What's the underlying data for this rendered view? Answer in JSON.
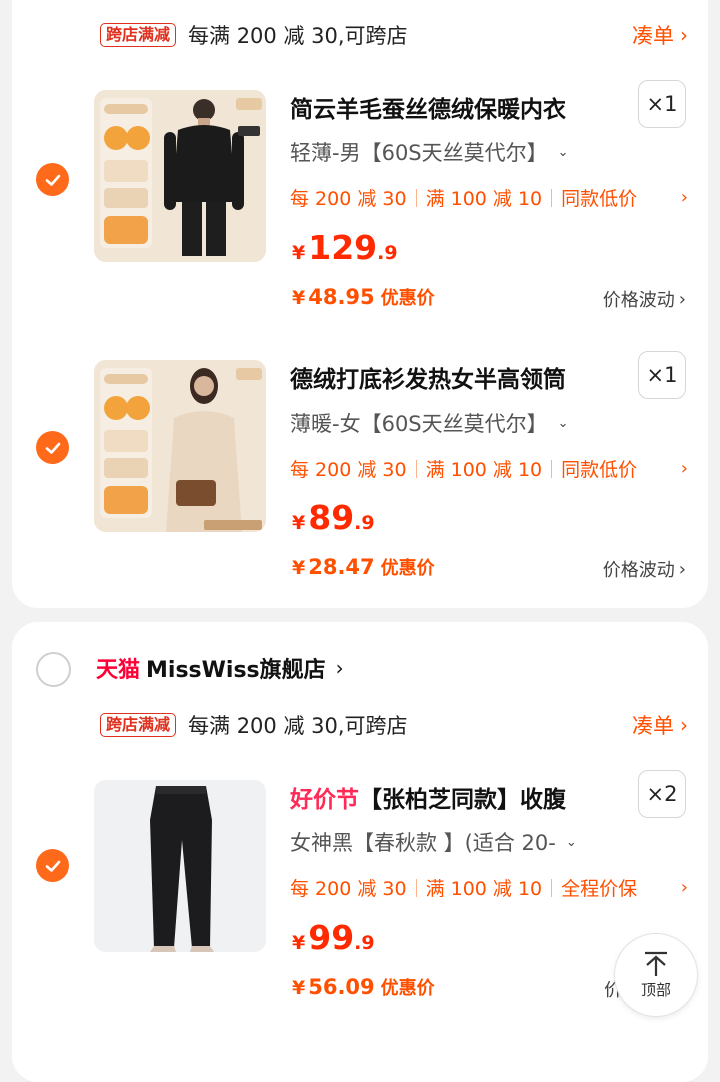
{
  "colors": {
    "accent": "#ff6a1a",
    "price": "#ff2a00",
    "promo": "#ff5000",
    "tmall": "#ff0036"
  },
  "store1": {
    "promo_tag": "跨店满减",
    "promo_text": "每满 200 减 30,可跨店",
    "coudan": "凑单",
    "items": [
      {
        "title": "简云羊毛蚕丝德绒保暖内衣",
        "qty": "×1",
        "variant": "轻薄-男【60S天丝莫代尔】",
        "promos": [
          "每 200 减 30",
          "满 100 减 10",
          "同款低价"
        ],
        "price_currency": "¥",
        "price_int": "129",
        "price_dec": ".9",
        "deal_currency": "¥",
        "deal_value": "48.95",
        "deal_label": "优惠价",
        "fluct": "价格波动",
        "checked": true,
        "icon": "product-thumbnail"
      },
      {
        "title": "德绒打底衫发热女半高领筒",
        "qty": "×1",
        "variant": "薄暖-女【60S天丝莫代尔】",
        "promos": [
          "每 200 减 30",
          "满 100 减 10",
          "同款低价"
        ],
        "price_currency": "¥",
        "price_int": "89",
        "price_dec": ".9",
        "deal_currency": "¥",
        "deal_value": "28.47",
        "deal_label": "优惠价",
        "fluct": "价格波动",
        "checked": true,
        "icon": "product-thumbnail"
      }
    ]
  },
  "store2": {
    "tmall": "天猫",
    "name": "MissWiss旗舰店",
    "promo_tag": "跨店满减",
    "promo_text": "每满 200 减 30,可跨店",
    "coudan": "凑单",
    "items": [
      {
        "title_highlight": "好价节",
        "title": "【张柏芝同款】收腹",
        "qty": "×2",
        "variant": "女神黑【春秋款 】(适合 20-",
        "promos": [
          "每 200 减 30",
          "满 100 减 10",
          "全程价保"
        ],
        "price_currency": "¥",
        "price_int": "99",
        "price_dec": ".9",
        "deal_currency": "¥",
        "deal_value": "56.09",
        "deal_label": "优惠价",
        "fluct": "价",
        "checked": true
      }
    ]
  },
  "back_to_top": {
    "label": "顶部",
    "icon": "arrow-up-icon"
  }
}
